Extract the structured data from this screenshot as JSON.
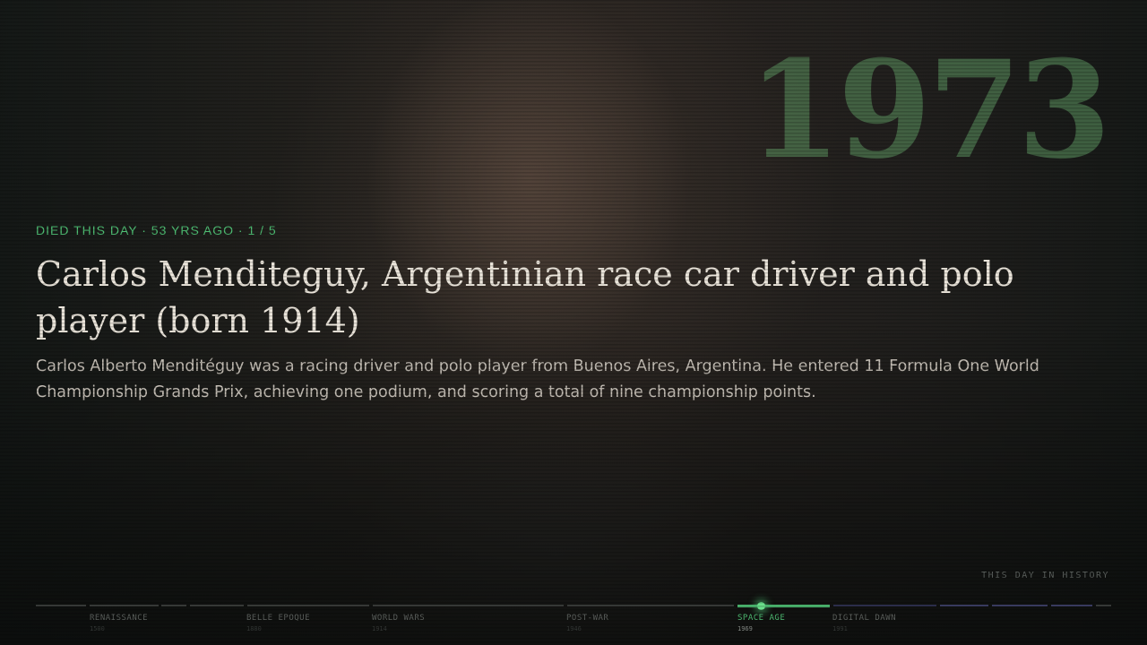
{
  "hero": {
    "year": "1973",
    "kicker": "DIED THIS DAY · 53 YRS AGO · 1 / 5",
    "title": "Carlos Menditeguy, Argentinian race car driver and polo player (born 1914)",
    "description": "Carlos Alberto Menditéguy was a racing driver and polo player from Buenos Aires, Argentina. He entered 11 Formula One World Championship Grands Prix, achieving one podium, and scoring a total of nine championship points."
  },
  "tagline": "THIS DAY IN HISTORY",
  "timeline": {
    "current_era": "SPACE AGE",
    "eras": [
      {
        "label": "RENAISSANCE",
        "year": "1500"
      },
      {
        "label": "BELLE EPOQUE",
        "year": "1880"
      },
      {
        "label": "WORLD WARS",
        "year": "1914"
      },
      {
        "label": "POST-WAR",
        "year": "1946"
      },
      {
        "label": "SPACE AGE",
        "year": "1969"
      },
      {
        "label": "DIGITAL DAWN",
        "year": "1991"
      }
    ]
  },
  "colors": {
    "accent": "#4fbf74",
    "year_watermark": "#5c9660",
    "title": "#ece6dc"
  }
}
